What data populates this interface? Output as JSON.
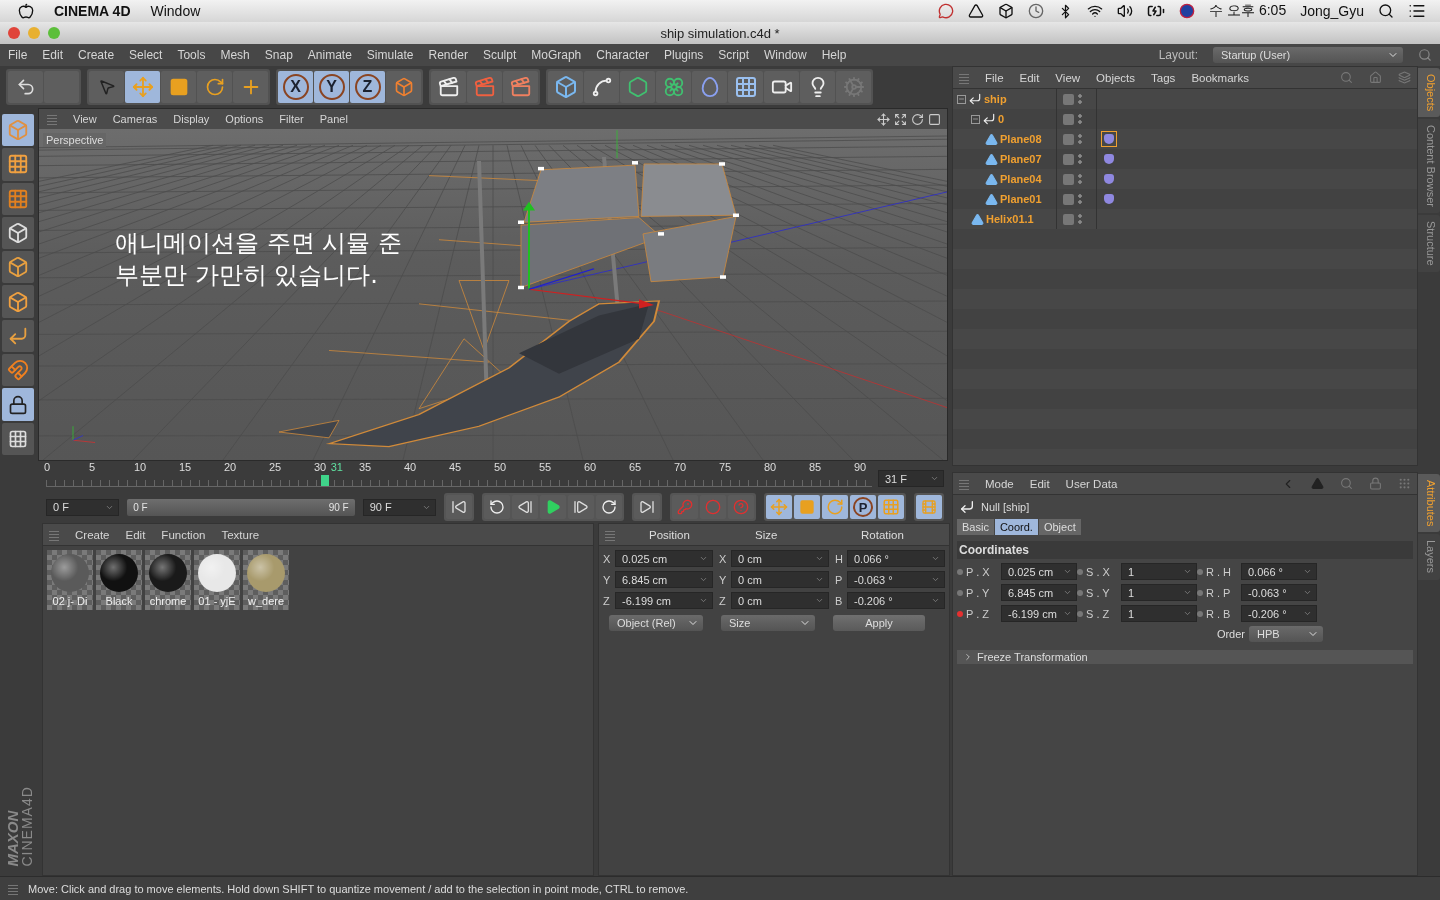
{
  "mac_menubar": {
    "app": "CINEMA 4D",
    "menus": [
      "Window"
    ],
    "clock": "수 오후 6:05",
    "user": "Jong_Gyu"
  },
  "window": {
    "title": "ship simulation.c4d *"
  },
  "menu": [
    "File",
    "Edit",
    "Create",
    "Select",
    "Tools",
    "Mesh",
    "Snap",
    "Animate",
    "Simulate",
    "Render",
    "Sculpt",
    "MoGraph",
    "Character",
    "Plugins",
    "Script",
    "Window",
    "Help"
  ],
  "layout": {
    "label": "Layout:",
    "value": "Startup (User)"
  },
  "toolbar": [
    {
      "kind": "undo",
      "selected": false
    },
    {
      "kind": "blank",
      "selected": false
    },
    {
      "kind": "select",
      "selected": false
    },
    {
      "kind": "move",
      "selected": true
    },
    {
      "kind": "scale",
      "selected": false
    },
    {
      "kind": "rotate",
      "selected": false
    },
    {
      "kind": "add",
      "selected": false
    },
    {
      "kind": "axis",
      "label": "X",
      "selected": true
    },
    {
      "kind": "axis",
      "label": "Y",
      "selected": true
    },
    {
      "kind": "axis",
      "label": "Z",
      "selected": true
    },
    {
      "kind": "coord",
      "selected": false
    },
    {
      "kind": "render_view",
      "selected": false
    },
    {
      "kind": "render_picture",
      "selected": false
    },
    {
      "kind": "render_settings",
      "selected": false
    },
    {
      "kind": "cube",
      "selected": false
    },
    {
      "kind": "spline",
      "selected": false
    },
    {
      "kind": "generator",
      "selected": false
    },
    {
      "kind": "array",
      "selected": false
    },
    {
      "kind": "deformer",
      "selected": false
    },
    {
      "kind": "floor",
      "selected": false
    },
    {
      "kind": "camera",
      "selected": false
    },
    {
      "kind": "light",
      "selected": false
    },
    {
      "kind": "disabled",
      "selected": false
    }
  ],
  "mode_tools": [
    {
      "kind": "model",
      "selected": true
    },
    {
      "kind": "texture",
      "selected": false
    },
    {
      "kind": "workplane",
      "selected": false
    },
    {
      "kind": "points",
      "selected": false
    },
    {
      "kind": "edges",
      "selected": false
    },
    {
      "kind": "polygons",
      "selected": false
    },
    {
      "kind": "axis",
      "selected": false
    },
    {
      "kind": "magnet",
      "selected": false
    },
    {
      "kind": "lock",
      "selected": true
    },
    {
      "kind": "enable",
      "selected": false
    }
  ],
  "viewport": {
    "menu": [
      "View",
      "Cameras",
      "Display",
      "Options",
      "Filter",
      "Panel"
    ],
    "camera": "Perspective",
    "caption": [
      "애니메이션을 주면 시뮬 준",
      "부분만 가만히 있습니다."
    ]
  },
  "timeline": {
    "ticks": [
      "0",
      "5",
      "10",
      "15",
      "20",
      "25",
      "30",
      "35",
      "40",
      "45",
      "50",
      "55",
      "60",
      "65",
      "70",
      "75",
      "80",
      "85",
      "90"
    ],
    "current": "31",
    "level": 0.344,
    "frame": "31 F"
  },
  "transport": {
    "start": "0 F",
    "range_start": "0 F",
    "range_end": "90 F",
    "end": "90 F",
    "level": 1
  },
  "key_toggles": [
    {
      "kind": "position",
      "selected": true
    },
    {
      "kind": "scale",
      "selected": true
    },
    {
      "kind": "rotation",
      "selected": true
    },
    {
      "kind": "parameter",
      "label": "P",
      "selected": true
    },
    {
      "kind": "pla",
      "selected": true
    }
  ],
  "logo": [
    "MAXON",
    "CINEMA4D"
  ],
  "materials": {
    "menu": [
      "Create",
      "Edit",
      "Function",
      "Texture"
    ],
    "items": [
      {
        "name": "02 j- Di",
        "color": "#5a5a5a"
      },
      {
        "name": "Black",
        "color": "#111111"
      },
      {
        "name": "chrome",
        "color": "#1a1a1a"
      },
      {
        "name": "01 - yjE",
        "color": "#e8e8e8"
      },
      {
        "name": "w_dere",
        "color": "#a89a6c"
      }
    ]
  },
  "coords": {
    "headers": [
      "Position",
      "Size",
      "Rotation"
    ],
    "rows": [
      [
        {
          "axis": "X",
          "value": "0.025 cm"
        },
        {
          "axis": "X",
          "value": "0 cm"
        },
        {
          "axis": "H",
          "value": "0.066 °"
        }
      ],
      [
        {
          "axis": "Y",
          "value": "6.845 cm"
        },
        {
          "axis": "Y",
          "value": "0 cm"
        },
        {
          "axis": "P",
          "value": "-0.063 °"
        }
      ],
      [
        {
          "axis": "Z",
          "value": "-6.199 cm"
        },
        {
          "axis": "Z",
          "value": "0 cm"
        },
        {
          "axis": "B",
          "value": "-0.206 °"
        }
      ]
    ],
    "mode": "Object (Rel)",
    "size_mode": "Size",
    "apply": "Apply"
  },
  "objects": {
    "menu": [
      "File",
      "Edit",
      "View",
      "Objects",
      "Tags",
      "Bookmarks"
    ],
    "tree": [
      {
        "name": "ship",
        "kind": "null",
        "selected": true,
        "expanded": true,
        "children": [
          {
            "name": "0",
            "kind": "null",
            "selected": true,
            "expanded": true,
            "children": [
              {
                "name": "Plane08",
                "kind": "plane",
                "selected": true,
                "tag": {
                  "selected": true
                }
              },
              {
                "name": "Plane07",
                "kind": "plane",
                "selected": true,
                "tag": {
                  "selected": false
                }
              },
              {
                "name": "Plane04",
                "kind": "plane",
                "selected": true,
                "tag": {
                  "selected": false
                }
              },
              {
                "name": "Plane01",
                "kind": "plane",
                "selected": true,
                "tag": {
                  "selected": false
                }
              }
            ]
          },
          {
            "name": "Helix01.1",
            "kind": "plane",
            "selected": true
          }
        ]
      }
    ]
  },
  "side_tabs_top": [
    {
      "label": "Objects",
      "selected": true
    },
    {
      "label": "Content Browser",
      "selected": false
    },
    {
      "label": "Structure",
      "selected": false
    }
  ],
  "attributes": {
    "menu": [
      "Mode",
      "Edit",
      "User Data"
    ],
    "title": "Null [ship]",
    "tabs": [
      {
        "label": "Basic",
        "selected": false
      },
      {
        "label": "Coord.",
        "selected": true
      },
      {
        "label": "Object",
        "selected": false
      }
    ],
    "section": "Coordinates",
    "rows": [
      [
        {
          "label": "P . X",
          "value": "0.025 cm",
          "keyed": false
        },
        {
          "label": "S . X",
          "value": "1",
          "keyed": false
        },
        {
          "label": "R . H",
          "value": "0.066 °",
          "keyed": false
        }
      ],
      [
        {
          "label": "P . Y",
          "value": "6.845 cm",
          "keyed": false
        },
        {
          "label": "S . Y",
          "value": "1",
          "keyed": false
        },
        {
          "label": "R . P",
          "value": "-0.063 °",
          "keyed": false
        }
      ],
      [
        {
          "label": "P . Z",
          "value": "-6.199 cm",
          "keyed": true
        },
        {
          "label": "S . Z",
          "value": "1",
          "keyed": false
        },
        {
          "label": "R . B",
          "value": "-0.206 °",
          "keyed": false
        }
      ]
    ],
    "order_label": "Order",
    "order": "HPB",
    "freeze": "Freeze Transformation",
    "freeze_expanded": false
  },
  "side_tabs_bottom": [
    {
      "label": "Attributes",
      "selected": true
    },
    {
      "label": "Layers",
      "selected": false
    }
  ],
  "status": "Move: Click and drag to move elements. Hold down SHIFT to quantize movement / add to the selection in point mode, CTRL to remove."
}
